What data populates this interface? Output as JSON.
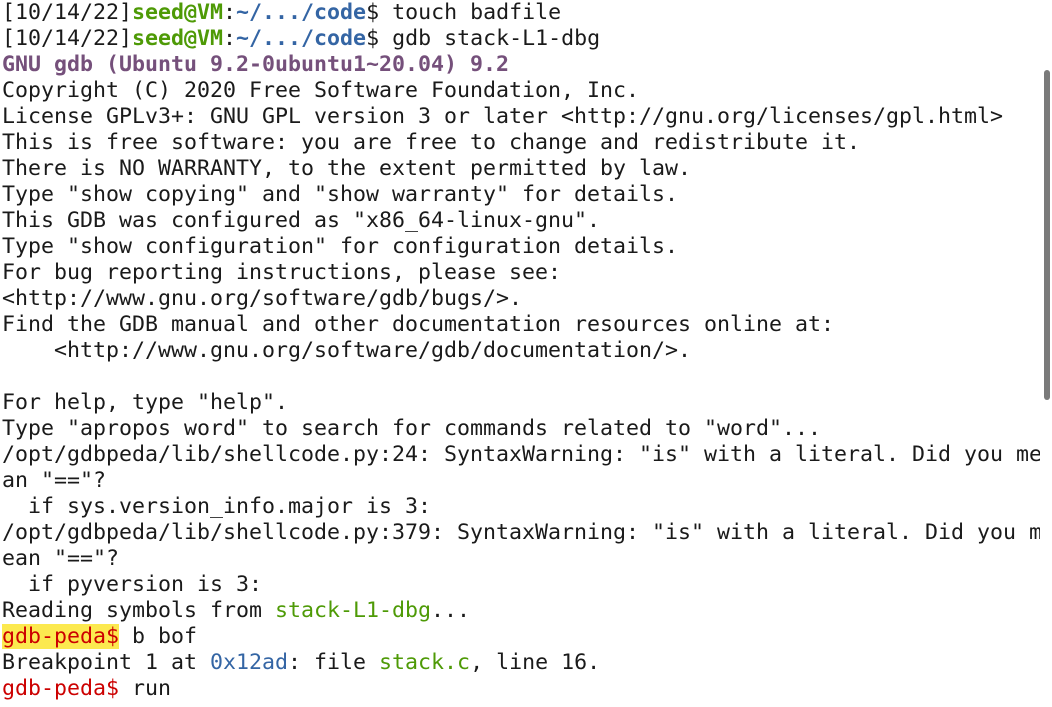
{
  "prompt1": {
    "date": "[10/14/22]",
    "userhost": "seed@VM",
    "colon": ":",
    "path": "~/.../code",
    "dollar": "$",
    "command": " touch badfile"
  },
  "prompt2": {
    "date": "[10/14/22]",
    "userhost": "seed@VM",
    "colon": ":",
    "path": "~/.../code",
    "dollar": "$",
    "command": " gdb stack-L1-dbg"
  },
  "banner": [
    "GNU gdb (Ubuntu 9.2-0ubuntu1~20.04) 9.2",
    "Copyright (C) 2020 Free Software Foundation, Inc.",
    "License GPLv3+: GNU GPL version 3 or later <http://gnu.org/licenses/gpl.html>",
    "This is free software: you are free to change and redistribute it.",
    "There is NO WARRANTY, to the extent permitted by law.",
    "Type \"show copying\" and \"show warranty\" for details.",
    "This GDB was configured as \"x86_64-linux-gnu\".",
    "Type \"show configuration\" for configuration details.",
    "For bug reporting instructions, please see:",
    "<http://www.gnu.org/software/gdb/bugs/>.",
    "Find the GDB manual and other documentation resources online at:",
    "    <http://www.gnu.org/software/gdb/documentation/>.",
    "",
    "For help, type \"help\".",
    "Type \"apropos word\" to search for commands related to \"word\"...",
    "/opt/gdbpeda/lib/shellcode.py:24: SyntaxWarning: \"is\" with a literal. Did you me",
    "an \"==\"?",
    "  if sys.version_info.major is 3:",
    "/opt/gdbpeda/lib/shellcode.py:379: SyntaxWarning: \"is\" with a literal. Did you m",
    "ean \"==\"?",
    "  if pyversion is 3:"
  ],
  "reading": {
    "prefix": "Reading symbols from ",
    "file": "stack-L1-dbg",
    "suffix": "..."
  },
  "peda_prompt": "gdb-peda$",
  "cmd_break": " b bof",
  "breakpoint": {
    "prefix": "Breakpoint 1 at ",
    "addr": "0x12ad",
    "mid": ": file ",
    "file": "stack.c",
    "suffix": ", line 16."
  },
  "cmd_run": " run",
  "colors": {
    "green": "#4e9a06",
    "blue": "#3465a4",
    "violet": "#75507b",
    "red": "#cc0000",
    "highlight": "#fce94f"
  }
}
